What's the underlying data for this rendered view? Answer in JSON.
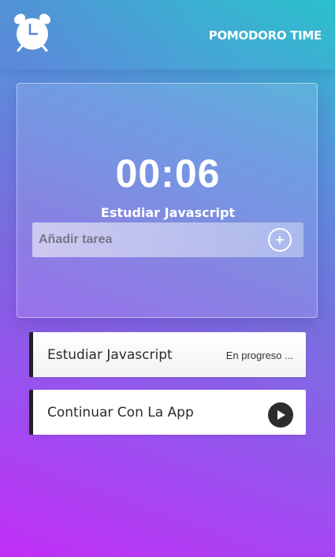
{
  "header": {
    "logo_icon": "alarm-clock-icon",
    "title": "POMODORO TIME"
  },
  "timer": {
    "time": "00:06",
    "current_task": "Estudiar Javascript",
    "input_placeholder": "Añadir tarea",
    "add_icon": "plus-circle-icon"
  },
  "tasks": [
    {
      "name": "Estudiar Javascript",
      "status": "En progreso ..."
    },
    {
      "name": "Continuar Con La App",
      "action_icon": "play-icon"
    }
  ],
  "colors": {
    "gradient_start": "#2ac1cc",
    "gradient_end": "#c22ff6",
    "task_border": "#222222"
  }
}
